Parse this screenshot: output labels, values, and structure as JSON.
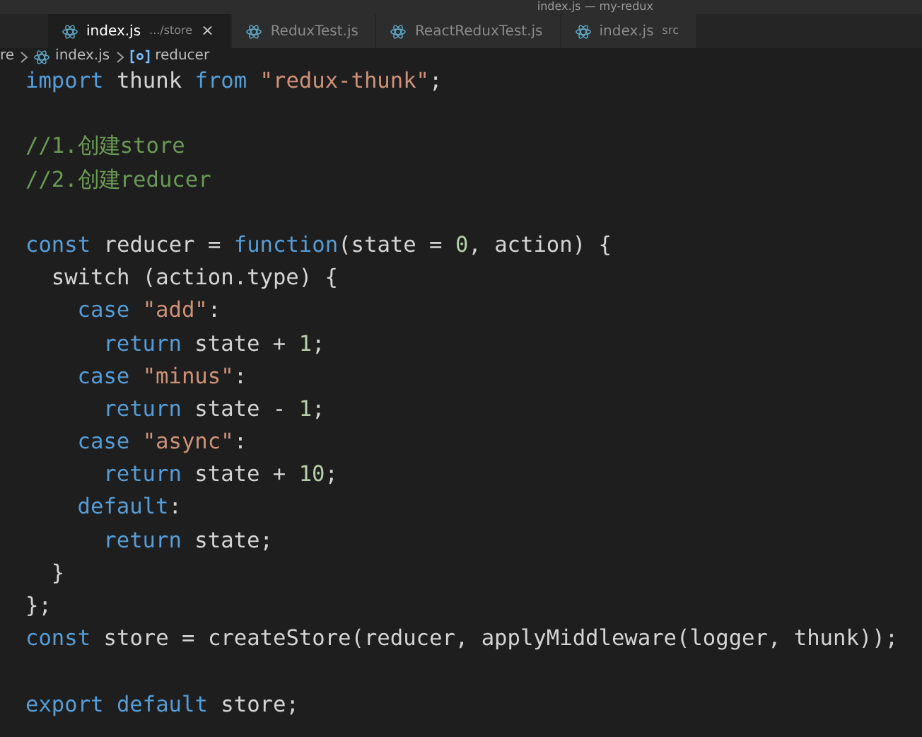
{
  "window": {
    "title": "index.js — my-redux"
  },
  "tabs": [
    {
      "name": "index.js",
      "detail": ".../store",
      "selected": true,
      "close": "×"
    },
    {
      "name": "ReduxTest.js",
      "selected": false
    },
    {
      "name": "ReactReduxTest.js",
      "selected": false
    },
    {
      "name": "index.js",
      "detail": "src",
      "selected": false
    }
  ],
  "breadcrumb": [
    {
      "label": "re",
      "kind": "folder"
    },
    {
      "label": "index.js",
      "kind": "file"
    },
    {
      "label": "reducer",
      "kind": "symbol"
    }
  ],
  "code": [
    {
      "tokens": [
        {
          "t": "import",
          "kind": "keyword"
        },
        {
          "t": " thunk ",
          "kind": "plain"
        },
        {
          "t": "from",
          "kind": "keyword"
        },
        {
          "t": " \"redux-thunk\"",
          "kind": "string"
        },
        {
          "t": ";",
          "kind": "plain"
        }
      ]
    },
    {
      "blank_before": true,
      "tokens": [
        {
          "t": "//1.创建store",
          "kind": "comment"
        }
      ]
    },
    {
      "tokens": [
        {
          "t": "//2.创建reducer",
          "kind": "comment"
        }
      ]
    },
    {
      "blank_before": true,
      "tokens": [
        {
          "t": "const",
          "kind": "keyword"
        },
        {
          "t": " reducer = ",
          "kind": "plain"
        },
        {
          "t": "function",
          "kind": "keyword"
        },
        {
          "t": "(state = ",
          "kind": "plain"
        },
        {
          "t": "0",
          "kind": "number"
        },
        {
          "t": ", action) {",
          "kind": "plain"
        }
      ],
      "children": [
        {
          "tokens": [
            {
              "t": "switch (action.type) {",
              "kind": "plain"
            }
          ],
          "children": [
            {
              "tokens": [
                {
                  "t": "case",
                  "kind": "keyword"
                },
                {
                  "t": " \"add\"",
                  "kind": "string"
                },
                {
                  "t": ":",
                  "kind": "plain"
                }
              ],
              "children": [
                {
                  "tokens": [
                    {
                      "t": "return",
                      "kind": "keyword"
                    },
                    {
                      "t": " state + ",
                      "kind": "plain"
                    },
                    {
                      "t": "1",
                      "kind": "number"
                    },
                    {
                      "t": ";",
                      "kind": "plain"
                    }
                  ]
                }
              ]
            },
            {
              "tokens": [
                {
                  "t": "case",
                  "kind": "keyword"
                },
                {
                  "t": " \"minus\"",
                  "kind": "string"
                },
                {
                  "t": ":",
                  "kind": "plain"
                }
              ],
              "children": [
                {
                  "tokens": [
                    {
                      "t": "return",
                      "kind": "keyword"
                    },
                    {
                      "t": " state - ",
                      "kind": "plain"
                    },
                    {
                      "t": "1",
                      "kind": "number"
                    },
                    {
                      "t": ";",
                      "kind": "plain"
                    }
                  ]
                }
              ]
            },
            {
              "tokens": [
                {
                  "t": "case",
                  "kind": "keyword"
                },
                {
                  "t": " \"async\"",
                  "kind": "string"
                },
                {
                  "t": ":",
                  "kind": "plain"
                }
              ],
              "children": [
                {
                  "tokens": [
                    {
                      "t": "return",
                      "kind": "keyword"
                    },
                    {
                      "t": " state + ",
                      "kind": "plain"
                    },
                    {
                      "t": "10",
                      "kind": "number"
                    },
                    {
                      "t": ";",
                      "kind": "plain"
                    }
                  ]
                }
              ]
            },
            {
              "tokens": [
                {
                  "t": "default",
                  "kind": "keyword"
                },
                {
                  "t": ":",
                  "kind": "plain"
                }
              ],
              "children": [
                {
                  "tokens": [
                    {
                      "t": "return",
                      "kind": "keyword"
                    },
                    {
                      "t": " state;",
                      "kind": "plain"
                    }
                  ]
                }
              ]
            }
          ]
        },
        {
          "tokens": [
            {
              "t": "}",
              "kind": "plain"
            }
          ]
        }
      ]
    },
    {
      "tokens": [
        {
          "t": "};",
          "kind": "plain"
        }
      ]
    },
    {
      "tokens": [
        {
          "t": "const",
          "kind": "keyword"
        },
        {
          "t": " store = createStore(reducer, applyMiddleware(logger, thunk));",
          "kind": "plain"
        }
      ]
    },
    {
      "blank_before": true,
      "tokens": [
        {
          "t": "export default",
          "kind": "keyword"
        },
        {
          "t": " store;",
          "kind": "plain"
        }
      ]
    }
  ]
}
